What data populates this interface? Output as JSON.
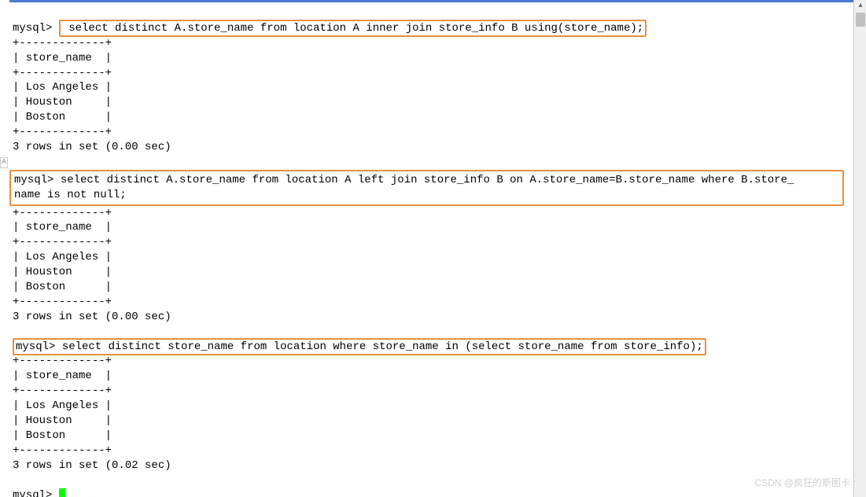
{
  "prompt": "mysql>",
  "queries": {
    "q1": " select distinct A.store_name from location A inner join store_info B using(store_name);",
    "q2_line1": "select distinct A.store_name from location A left join store_info B on A.store_name=B.store_name where B.store_",
    "q2_line2": "name is not null;",
    "q3": "select distinct store_name from location where store_name in (select store_name from store_info);"
  },
  "table": {
    "border": "+-------------+",
    "header": "| store_name  |",
    "rows": [
      "| Los Angeles |",
      "| Houston     |",
      "| Boston      |"
    ]
  },
  "results": {
    "r1": "3 rows in set (0.00 sec)",
    "r2": "3 rows in set (0.00 sec)",
    "r3": "3 rows in set (0.02 sec)"
  },
  "watermark": "CSDN @疯狂的斯图卡",
  "left_tab": "A"
}
